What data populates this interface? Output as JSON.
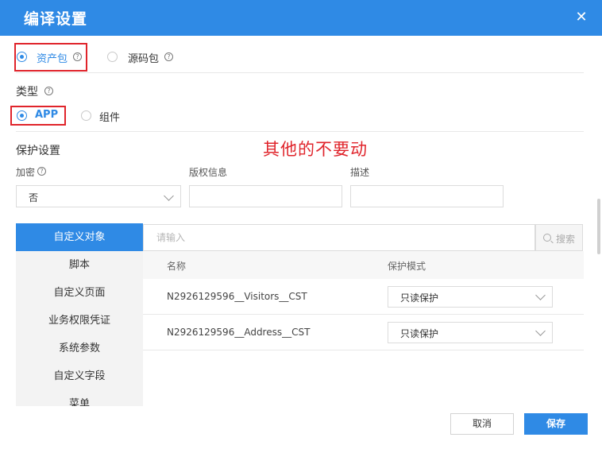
{
  "dialog": {
    "title": "编译设置",
    "close_icon": "close-icon"
  },
  "package_type": {
    "options": [
      {
        "label": "资产包",
        "selected": true
      },
      {
        "label": "源码包",
        "selected": false
      }
    ]
  },
  "type_section": {
    "label": "类型",
    "options": [
      {
        "label": "APP",
        "selected": true
      },
      {
        "label": "组件",
        "selected": false
      }
    ]
  },
  "protection": {
    "title": "保护设置",
    "annotation": "其他的不要动",
    "encrypt": {
      "label": "加密",
      "value": "否"
    },
    "copyright": {
      "label": "版权信息",
      "value": ""
    },
    "description": {
      "label": "描述",
      "value": ""
    }
  },
  "sidebar": {
    "items": [
      {
        "label": "自定义对象",
        "active": true
      },
      {
        "label": "脚本"
      },
      {
        "label": "自定义页面"
      },
      {
        "label": "业务权限凭证"
      },
      {
        "label": "系统参数"
      },
      {
        "label": "自定义字段"
      },
      {
        "label": "菜单"
      }
    ]
  },
  "search": {
    "placeholder": "请输入",
    "button_label": "搜索"
  },
  "table": {
    "headers": [
      "名称",
      "保护模式"
    ],
    "rows": [
      {
        "name": "N2926129596__Visitors__CST",
        "mode": "只读保护"
      },
      {
        "name": "N2926129596__Address__CST",
        "mode": "只读保护"
      }
    ]
  },
  "footer": {
    "cancel_label": "取消",
    "save_label": "保存"
  },
  "colors": {
    "primary": "#2f8ae5",
    "annotation_red": "#e0242b"
  }
}
